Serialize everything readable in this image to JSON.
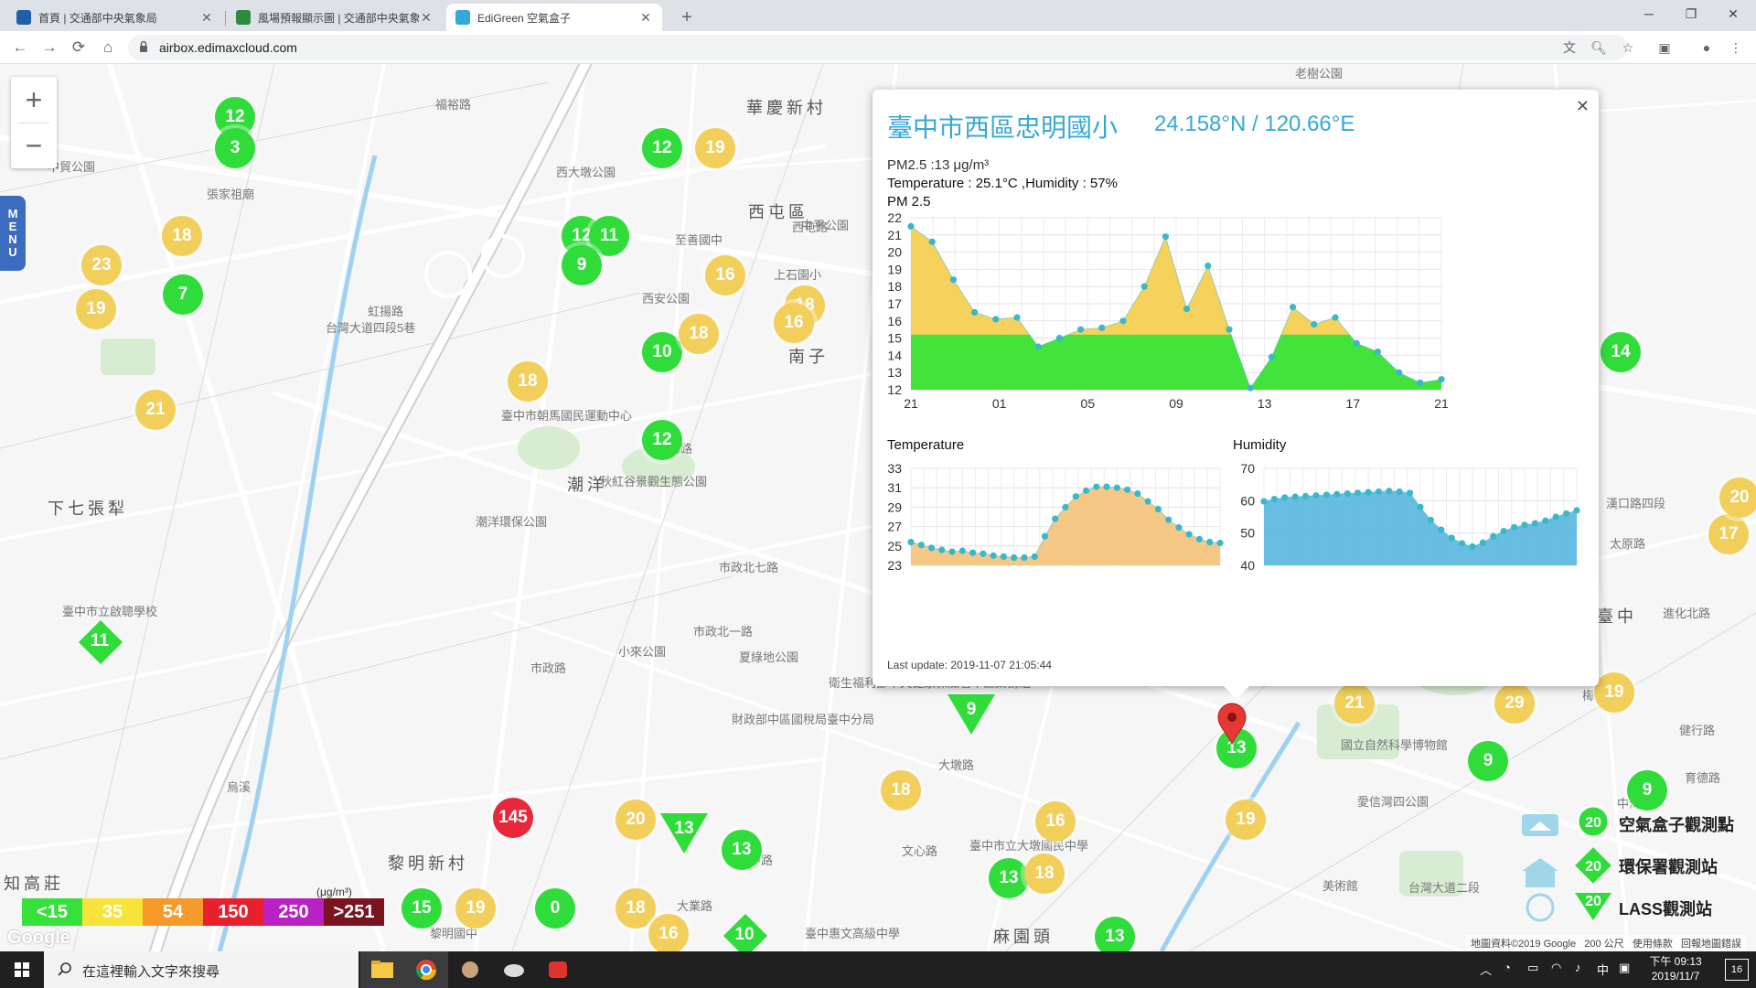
{
  "browser": {
    "tabs": [
      {
        "title": "首頁 | 交通部中央氣象局",
        "active": false,
        "favicon_color": "#1f5fa8"
      },
      {
        "title": "風場預報顯示圖 | 交通部中央氣象局",
        "active": false,
        "favicon_color": "#2e8b3d"
      },
      {
        "title": "EdiGreen 空氣盒子",
        "active": true,
        "favicon_color": "#35a8d6"
      }
    ],
    "url": "airbox.edimaxcloud.com"
  },
  "map": {
    "labels": [
      {
        "text": "華慶新村",
        "cls": "big"
      },
      {
        "text": "西屯區",
        "cls": "big"
      },
      {
        "text": "南子",
        "cls": "big"
      },
      {
        "text": "潮洋",
        "cls": "big"
      },
      {
        "text": "下七張犁",
        "cls": "big"
      },
      {
        "text": "黎明新村",
        "cls": "big"
      },
      {
        "text": "臺中",
        "cls": "big"
      },
      {
        "text": "知高莊",
        "cls": "big"
      },
      {
        "text": "麻園頭",
        "cls": "big"
      },
      {
        "text": "至善國中",
        "cls": "small"
      },
      {
        "text": "西安公園",
        "cls": "small"
      },
      {
        "text": "上石園小",
        "cls": "small"
      },
      {
        "text": "臺中市朝馬國民運動中心",
        "cls": "small"
      },
      {
        "text": "秋紅谷景觀生態公園",
        "cls": "small"
      },
      {
        "text": "潮洋環保公園",
        "cls": "small"
      },
      {
        "text": "小來公園",
        "cls": "small"
      },
      {
        "text": "夏綠地公園",
        "cls": "small"
      },
      {
        "text": "衛生福利部中央健康保險署中區業務組",
        "cls": "small"
      },
      {
        "text": "財政部中區國稅局臺中分局",
        "cls": "small"
      },
      {
        "text": "臺中市立大墩國民中學",
        "cls": "small"
      },
      {
        "text": "國立自然科學博物館",
        "cls": "small"
      },
      {
        "text": "臺中市立啟聰學校",
        "cls": "small"
      },
      {
        "text": "張家祖廟",
        "cls": "small"
      },
      {
        "text": "福裕路",
        "cls": "small"
      },
      {
        "text": "台灣大道四段5巷",
        "cls": "small"
      },
      {
        "text": "台灣大道二段",
        "cls": "small"
      },
      {
        "text": "漢口路四段",
        "cls": "small"
      },
      {
        "text": "太原路",
        "cls": "small"
      },
      {
        "text": "進化北路",
        "cls": "small"
      },
      {
        "text": "健行路",
        "cls": "small"
      },
      {
        "text": "育德路",
        "cls": "small"
      },
      {
        "text": "梅亭街",
        "cls": "small"
      },
      {
        "text": "美術館",
        "cls": "small"
      },
      {
        "text": "愛信灣四公園",
        "cls": "small"
      },
      {
        "text": "中海",
        "cls": "small"
      },
      {
        "text": "老樹公園",
        "cls": "small"
      },
      {
        "text": "市政路",
        "cls": "small"
      },
      {
        "text": "市政北七路",
        "cls": "small"
      },
      {
        "text": "市政北一路",
        "cls": "small"
      },
      {
        "text": "文心路",
        "cls": "small"
      },
      {
        "text": "大墩路",
        "cls": "small"
      },
      {
        "text": "朝馬路",
        "cls": "small"
      },
      {
        "text": "大業路",
        "cls": "small"
      },
      {
        "text": "惠中路",
        "cls": "small"
      },
      {
        "text": "烏溪",
        "cls": "small"
      },
      {
        "text": "虹揚路",
        "cls": "small"
      },
      {
        "text": "西屯路",
        "cls": "small"
      },
      {
        "text": "中港公園",
        "cls": "small"
      },
      {
        "text": "中平公園",
        "cls": "small"
      },
      {
        "text": "西大墩公園",
        "cls": "small"
      },
      {
        "text": "中貿公園",
        "cls": "small"
      },
      {
        "text": "臺中惠文高級中學",
        "cls": "small"
      },
      {
        "text": "黎明國中",
        "cls": "small"
      }
    ],
    "markers": [
      {
        "v": "12",
        "c": "g",
        "s": "c"
      },
      {
        "v": "3",
        "c": "g",
        "s": "c"
      },
      {
        "v": "18",
        "c": "y",
        "s": "c"
      },
      {
        "v": "23",
        "c": "y",
        "s": "c"
      },
      {
        "v": "19",
        "c": "y",
        "s": "c"
      },
      {
        "v": "7",
        "c": "g",
        "s": "c"
      },
      {
        "v": "21",
        "c": "y",
        "s": "c"
      },
      {
        "v": "12",
        "c": "g",
        "s": "c"
      },
      {
        "v": "11",
        "c": "g",
        "s": "c"
      },
      {
        "v": "9",
        "c": "g",
        "s": "c"
      },
      {
        "v": "12",
        "c": "g",
        "s": "c"
      },
      {
        "v": "19",
        "c": "y",
        "s": "c"
      },
      {
        "v": "16",
        "c": "y",
        "s": "c"
      },
      {
        "v": "18",
        "c": "y",
        "s": "c"
      },
      {
        "v": "16",
        "c": "y",
        "s": "c"
      },
      {
        "v": "10",
        "c": "g",
        "s": "c"
      },
      {
        "v": "18",
        "c": "y",
        "s": "c"
      },
      {
        "v": "18",
        "c": "y",
        "s": "c"
      },
      {
        "v": "12",
        "c": "g",
        "s": "c"
      },
      {
        "v": "14",
        "c": "g",
        "s": "c"
      },
      {
        "v": "17",
        "c": "y",
        "s": "c"
      },
      {
        "v": "20",
        "c": "y",
        "s": "c"
      },
      {
        "v": "19",
        "c": "y",
        "s": "c"
      },
      {
        "v": "29",
        "c": "y",
        "s": "c"
      },
      {
        "v": "21",
        "c": "y",
        "s": "c"
      },
      {
        "v": "9",
        "c": "g",
        "s": "c"
      },
      {
        "v": "9",
        "c": "g",
        "s": "c"
      },
      {
        "v": "13",
        "c": "g",
        "s": "c"
      },
      {
        "v": "19",
        "c": "y",
        "s": "c"
      },
      {
        "v": "18",
        "c": "y",
        "s": "c"
      },
      {
        "v": "16",
        "c": "y",
        "s": "c"
      },
      {
        "v": "13",
        "c": "g",
        "s": "c"
      },
      {
        "v": "18",
        "c": "y",
        "s": "c"
      },
      {
        "v": "145",
        "c": "r",
        "s": "c"
      },
      {
        "v": "20",
        "c": "y",
        "s": "c"
      },
      {
        "v": "13",
        "c": "g",
        "s": "c"
      },
      {
        "v": "15",
        "c": "g",
        "s": "c"
      },
      {
        "v": "19",
        "c": "y",
        "s": "c"
      },
      {
        "v": "0",
        "c": "g",
        "s": "c"
      },
      {
        "v": "18",
        "c": "y",
        "s": "c"
      },
      {
        "v": "16",
        "c": "y",
        "s": "c"
      },
      {
        "v": "13",
        "c": "g",
        "s": "c"
      },
      {
        "v": "9",
        "c": "g",
        "s": "t"
      },
      {
        "v": "13",
        "c": "g",
        "s": "t"
      },
      {
        "v": "11",
        "c": "g",
        "s": "d"
      },
      {
        "v": "10",
        "c": "g",
        "s": "d"
      }
    ],
    "menu_label": [
      "M",
      "E",
      "N",
      "U"
    ],
    "legend": {
      "unit": "(μg/m³)",
      "items": [
        {
          "label": "<15",
          "color": "#37e13b"
        },
        {
          "label": "35",
          "color": "#f7e43a"
        },
        {
          "label": "54",
          "color": "#f59a29"
        },
        {
          "label": "150",
          "color": "#e8202e"
        },
        {
          "label": "250",
          "color": "#b921c4"
        },
        {
          "label": ">251",
          "color": "#7a1520"
        }
      ]
    },
    "station_key": [
      {
        "label": "空氣盒子觀測點",
        "value": "20"
      },
      {
        "label": "環保署觀測站",
        "value": "20"
      },
      {
        "label": "LASS觀測站",
        "value": "20"
      }
    ],
    "copyright": "地圖資料©2019 Google",
    "scale": "200 公尺",
    "terms": "使用條款",
    "report": "回報地圖錯誤",
    "google_logo": "Google"
  },
  "popup": {
    "title": "臺中市西區忠明國小",
    "coords": "24.158°N / 120.66°E",
    "pm_line": "PM2.5 :13 μg/m³",
    "temp_line": "Temperature : 25.1°C ,Humidity : 57%",
    "pm_chart_title": "PM 2.5",
    "temp_chart_title": "Temperature",
    "hum_chart_title": "Humidity",
    "last_update": "Last update: 2019-11-07 21:05:44"
  },
  "chart_data": [
    {
      "type": "area",
      "title": "PM 2.5",
      "x_tick_labels": [
        "21",
        "01",
        "05",
        "09",
        "13",
        "17",
        "21"
      ],
      "y_ticks": [
        12,
        13,
        14,
        15,
        16,
        17,
        18,
        19,
        20,
        21,
        22
      ],
      "ylim": [
        12,
        22
      ],
      "threshold": 15.2,
      "colors": {
        "above": "#f6d15c",
        "below": "#44e33b",
        "points": "#39b8c9"
      },
      "values": [
        21.5,
        20.6,
        18.4,
        16.5,
        16.1,
        16.2,
        14.5,
        15.0,
        15.5,
        15.6,
        16.0,
        18.0,
        20.9,
        16.7,
        19.2,
        15.5,
        12.1,
        13.9,
        16.8,
        15.8,
        16.2,
        14.7,
        14.2,
        13.0,
        12.4,
        12.6
      ],
      "grid": true
    },
    {
      "type": "area",
      "title": "Temperature",
      "y_ticks": [
        23,
        25,
        27,
        29,
        31,
        33
      ],
      "ylim": [
        23,
        33
      ],
      "colors": {
        "fill": "#f5c27a",
        "points": "#39b8c9"
      },
      "values": [
        25.4,
        25.1,
        24.8,
        24.6,
        24.4,
        24.5,
        24.3,
        24.2,
        24.0,
        23.9,
        23.8,
        23.8,
        23.9,
        26.0,
        27.8,
        29.0,
        30.1,
        30.7,
        31.1,
        31.1,
        31.0,
        30.8,
        30.4,
        29.6,
        28.8,
        27.7,
        26.9,
        26.2,
        25.7,
        25.4,
        25.3
      ],
      "grid": true
    },
    {
      "type": "area",
      "title": "Humidity",
      "y_ticks": [
        40,
        50,
        60,
        70
      ],
      "ylim": [
        40,
        70
      ],
      "colors": {
        "fill": "#57b7df",
        "points": "#39b8c9"
      },
      "values": [
        59.8,
        60.5,
        61.0,
        61.2,
        61.4,
        61.6,
        61.8,
        62.0,
        62.2,
        62.4,
        62.6,
        62.8,
        63.0,
        62.8,
        62.4,
        58.0,
        54.0,
        51.0,
        48.5,
        46.8,
        45.8,
        47.0,
        49.0,
        50.6,
        51.8,
        52.5,
        53.0,
        53.8,
        55.0,
        56.0,
        57.0
      ],
      "grid": true
    }
  ],
  "taskbar": {
    "search_placeholder": "在這裡輸入文字來搜尋",
    "ime": "中",
    "time": "下午 09:13",
    "date": "2019/11/7",
    "notifications": "16"
  }
}
